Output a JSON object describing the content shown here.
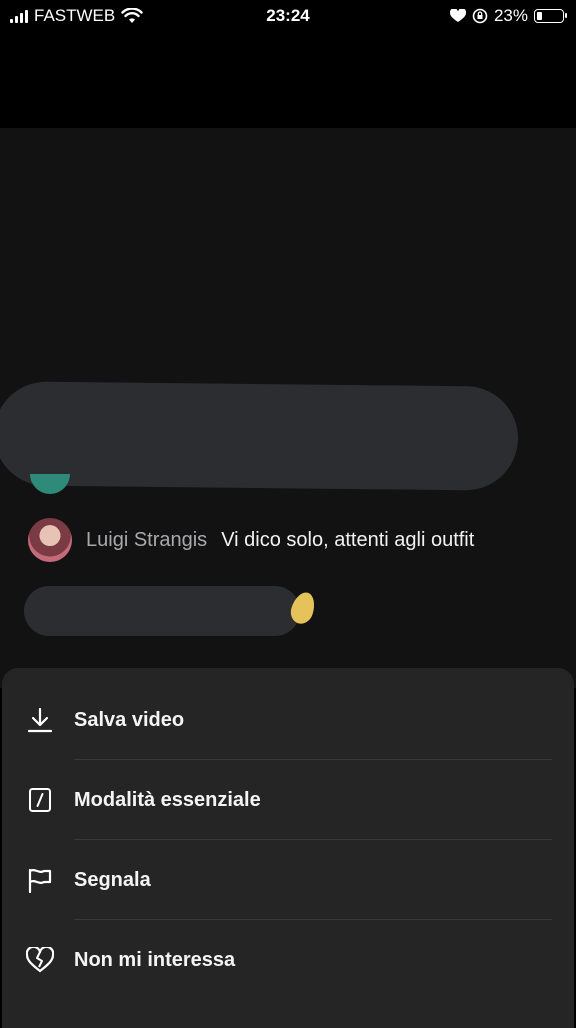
{
  "status_bar": {
    "carrier": "FASTWEB",
    "time": "23:24",
    "battery_percent": "23%",
    "battery_level": 0.23
  },
  "video": {
    "comment": {
      "username": "Luigi Strangis",
      "text": "Vi dico solo, attenti agli outfit"
    }
  },
  "menu": {
    "items": [
      {
        "label": "Salva video",
        "icon": "download-icon"
      },
      {
        "label": "Modalità essenziale",
        "icon": "essential-mode-icon"
      },
      {
        "label": "Segnala",
        "icon": "flag-icon"
      },
      {
        "label": "Non mi interessa",
        "icon": "broken-heart-icon"
      }
    ]
  },
  "colors": {
    "sheet_background": "#252525",
    "screen_background": "#121212",
    "redaction": "#2b2d31"
  }
}
